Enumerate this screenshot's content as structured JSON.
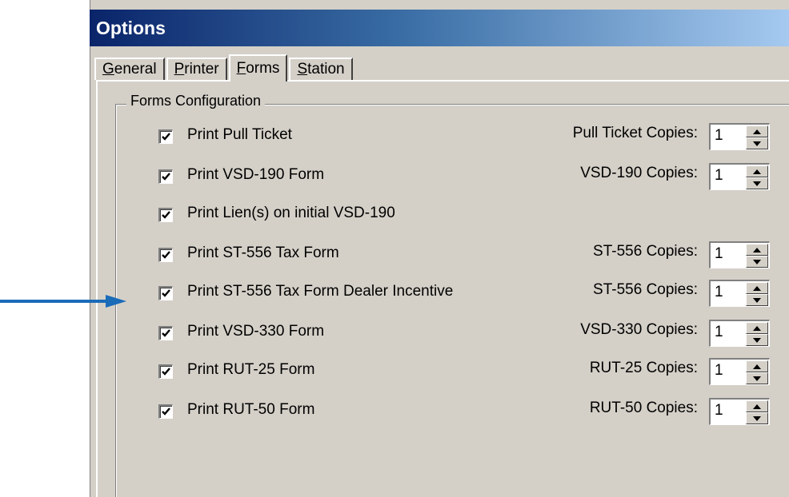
{
  "window": {
    "title": "Options",
    "tabs": [
      {
        "label_pre": "",
        "accel": "G",
        "label_post": "eneral",
        "active": false
      },
      {
        "label_pre": "",
        "accel": "P",
        "label_post": "rinter",
        "active": false
      },
      {
        "label_pre": "",
        "accel": "F",
        "label_post": "orms",
        "active": true
      },
      {
        "label_pre": "",
        "accel": "S",
        "label_post": "tation",
        "active": false
      }
    ]
  },
  "group": {
    "legend": "Forms Configuration",
    "rows": [
      {
        "checkbox_label": "Print Pull Ticket",
        "checked": true,
        "copies_label": "Pull Ticket Copies:",
        "copies_value": "1"
      },
      {
        "checkbox_label": "Print VSD-190 Form",
        "checked": true,
        "copies_label": "VSD-190 Copies:",
        "copies_value": "1"
      },
      {
        "checkbox_label": "Print Lien(s) on initial VSD-190",
        "checked": true,
        "copies_label": "",
        "copies_value": ""
      },
      {
        "checkbox_label": "Print ST-556 Tax Form",
        "checked": true,
        "copies_label": "ST-556 Copies:",
        "copies_value": "1"
      },
      {
        "checkbox_label": "Print ST-556 Tax Form Dealer Incentive",
        "checked": true,
        "copies_label": "ST-556 Copies:",
        "copies_value": "1"
      },
      {
        "checkbox_label": "Print VSD-330 Form",
        "checked": true,
        "copies_label": "VSD-330 Copies:",
        "copies_value": "1"
      },
      {
        "checkbox_label": "Print RUT-25 Form",
        "checked": true,
        "copies_label": "RUT-25 Copies:",
        "copies_value": "1"
      },
      {
        "checkbox_label": "Print RUT-50 Form",
        "checked": true,
        "copies_label": "RUT-50 Copies:",
        "copies_value": "1"
      }
    ]
  },
  "annotation": {
    "arrow_color": "#1a6bb8",
    "points_to_row": 4
  },
  "colors": {
    "titlebar_start": "#0a246a",
    "titlebar_end": "#a6caf0",
    "face": "#d4d0c8"
  },
  "icons": {
    "checkmark": "check-mark-icon",
    "spin_up": "triangle-up-icon",
    "spin_down": "triangle-down-icon",
    "arrow": "arrow-right-icon"
  }
}
